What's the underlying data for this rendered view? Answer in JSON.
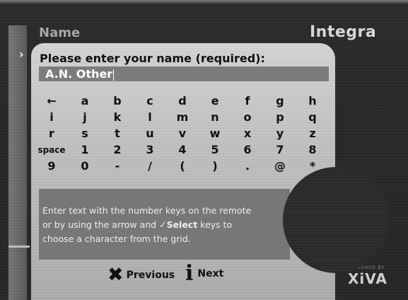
{
  "header": {
    "title": "Name",
    "brand": "Integra",
    "nav_indicator": "›"
  },
  "dialog": {
    "prompt": "Please enter your name (required):",
    "input_value": "A.N. Other",
    "keyboard_rows": [
      [
        "←",
        "a",
        "b",
        "c",
        "d",
        "e",
        "f",
        "g",
        "h"
      ],
      [
        "i",
        "j",
        "k",
        "l",
        "m",
        "n",
        "o",
        "p",
        "q"
      ],
      [
        "r",
        "s",
        "t",
        "u",
        "v",
        "w",
        "x",
        "y",
        "z"
      ],
      [
        "space",
        "1",
        "2",
        "3",
        "4",
        "5",
        "6",
        "7",
        "8"
      ],
      [
        "9",
        "0",
        "-",
        "/",
        "(",
        ")",
        ".",
        "@",
        "*"
      ]
    ],
    "help_line1": "Enter text with the number keys on the remote",
    "help_line2_pre": "or by using the arrow and ",
    "help_check": "✓",
    "help_select": "Select",
    "help_line2_post": " keys to",
    "help_line3": "choose a character from the grid."
  },
  "footer": {
    "previous_icon": "x-icon",
    "previous_label": "Previous",
    "next_icon": "info-icon",
    "next_label": "Next"
  },
  "branding": {
    "powered_by": "POWERED BY",
    "xiva": "XiVA"
  }
}
